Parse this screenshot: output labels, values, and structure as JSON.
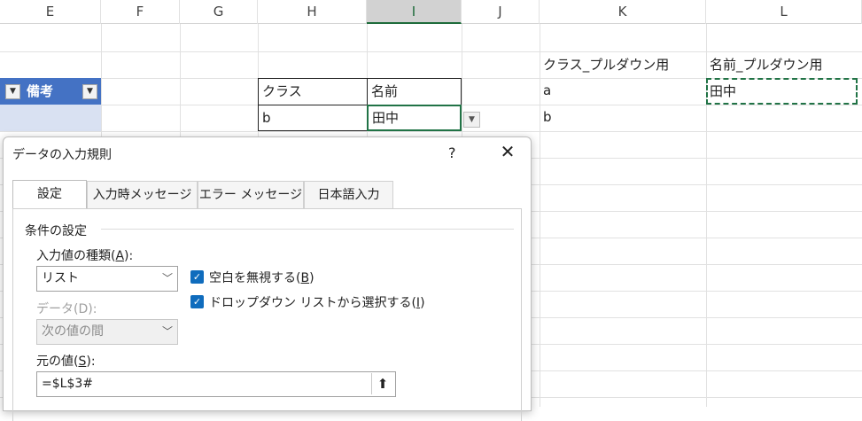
{
  "columns": [
    "E",
    "F",
    "G",
    "H",
    "I",
    "J",
    "K",
    "L"
  ],
  "selected_column": "I",
  "sheet": {
    "K_header": "クラス_プルダウン用",
    "L_header": "名前_プルダウン用",
    "H_label": "クラス",
    "I_label": "名前",
    "H_value": "b",
    "I_value": "田中",
    "K_row1": "a",
    "K_row2": "b",
    "L_row1": "田中",
    "table_header_E": "備考"
  },
  "dialog": {
    "title": "データの入力規則",
    "help": "?",
    "close": "✕",
    "tabs": [
      "設定",
      "入力時メッセージ",
      "エラー メッセージ",
      "日本語入力"
    ],
    "active_tab": 0,
    "section_title": "条件の設定",
    "allow_label_prefix": "入力値の種類(",
    "allow_label_key": "A",
    "allow_label_suffix": "):",
    "allow_value": "リスト",
    "data_label": "データ(D):",
    "data_value": "次の値の間",
    "ignore_blank_prefix": "空白を無視する(",
    "ignore_blank_key": "B",
    "ignore_blank_suffix": ")",
    "dropdown_prefix": "ドロップダウン リストから選択する(",
    "dropdown_key": "I",
    "dropdown_suffix": ")",
    "source_label_prefix": "元の値(",
    "source_label_key": "S",
    "source_label_suffix": "):",
    "source_value": "=$L$3#"
  },
  "colors": {
    "accent_green": "#217346",
    "table_blue": "#4472c4",
    "check_blue": "#0f6cbd"
  }
}
